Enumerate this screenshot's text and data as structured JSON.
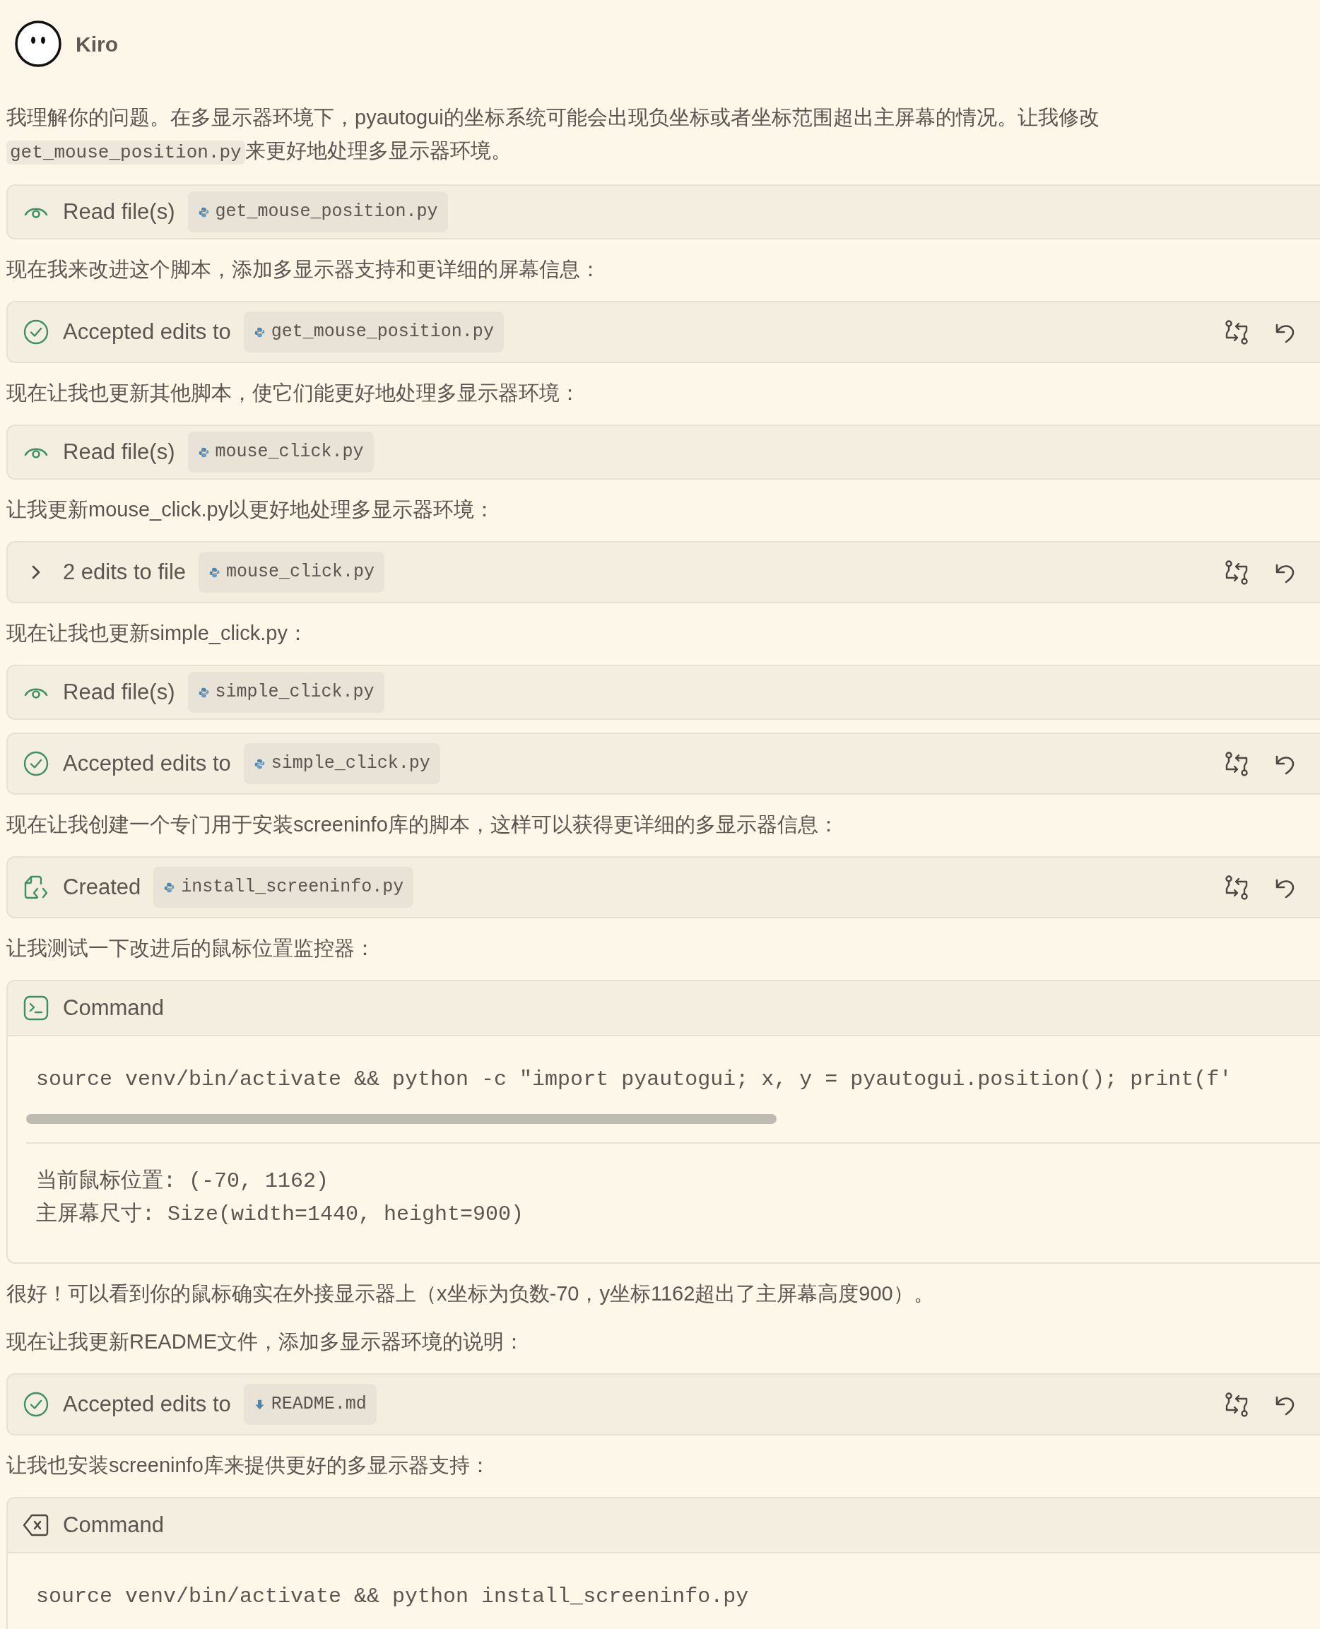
{
  "assistant": {
    "name": "Kiro"
  },
  "items": [
    {
      "kind": "text",
      "parts": [
        {
          "text": "我理解你的问题。在多显示器环境下，pyautogui的坐标系统可能会出现负坐标或者坐标范围超出主屏幕的情况。让我修改",
          "code": false
        },
        {
          "text": "get_mouse_position.py",
          "code": true
        },
        {
          "text": "来更好地处理多显示器环境。",
          "code": false
        }
      ]
    },
    {
      "kind": "read",
      "label": "Read file(s)",
      "file": {
        "name": "get_mouse_position.py",
        "kind": "python"
      },
      "actions": false
    },
    {
      "kind": "text",
      "parts": [
        {
          "text": "现在我来改进这个脚本，添加多显示器支持和更详细的屏幕信息：",
          "code": false
        }
      ]
    },
    {
      "kind": "accepted",
      "label": "Accepted edits to",
      "file": {
        "name": "get_mouse_position.py",
        "kind": "python"
      },
      "actions": true
    },
    {
      "kind": "text",
      "parts": [
        {
          "text": "现在让我也更新其他脚本，使它们能更好地处理多显示器环境：",
          "code": false
        }
      ]
    },
    {
      "kind": "read",
      "label": "Read file(s)",
      "file": {
        "name": "mouse_click.py",
        "kind": "python"
      },
      "actions": false
    },
    {
      "kind": "text",
      "parts": [
        {
          "text": "让我更新mouse_click.py以更好地处理多显示器环境：",
          "code": false
        }
      ]
    },
    {
      "kind": "edits",
      "label": "2 edits to file",
      "file": {
        "name": "mouse_click.py",
        "kind": "python"
      },
      "actions": true
    },
    {
      "kind": "text",
      "parts": [
        {
          "text": "现在让我也更新simple_click.py：",
          "code": false
        }
      ]
    },
    {
      "kind": "read",
      "label": "Read file(s)",
      "file": {
        "name": "simple_click.py",
        "kind": "python"
      },
      "actions": false
    },
    {
      "kind": "accepted",
      "label": "Accepted edits to",
      "file": {
        "name": "simple_click.py",
        "kind": "python"
      },
      "actions": true
    },
    {
      "kind": "text",
      "parts": [
        {
          "text": "现在让我创建一个专门用于安装screeninfo库的脚本，这样可以获得更详细的多显示器信息：",
          "code": false
        }
      ]
    },
    {
      "kind": "created",
      "label": "Created",
      "file": {
        "name": "install_screeninfo.py",
        "kind": "python"
      },
      "actions": true
    },
    {
      "kind": "text",
      "parts": [
        {
          "text": "让我测试一下改进后的鼠标位置监控器：",
          "code": false
        }
      ]
    },
    {
      "kind": "command",
      "label": "Command",
      "command": "source venv/bin/activate && python -c \"import pyautogui; x, y = pyautogui.position(); print(f'",
      "scrollable": true,
      "output": [
        "当前鼠标位置: (-70, 1162)",
        "主屏幕尺寸: Size(width=1440, height=900)"
      ]
    },
    {
      "kind": "text",
      "parts": [
        {
          "text": "很好！可以看到你的鼠标确实在外接显示器上（x坐标为负数-70，y坐标1162超出了主屏幕高度900）。",
          "code": false
        }
      ]
    },
    {
      "kind": "text",
      "parts": [
        {
          "text": "现在让我更新README文件，添加多显示器环境的说明：",
          "code": false
        }
      ]
    },
    {
      "kind": "accepted",
      "label": "Accepted edits to",
      "file": {
        "name": "README.md",
        "kind": "markdown"
      },
      "actions": true
    },
    {
      "kind": "text",
      "parts": [
        {
          "text": "让我也安装screeninfo库来提供更好的多显示器支持：",
          "code": false
        }
      ]
    },
    {
      "kind": "cancelled_command",
      "label": "Command",
      "command": "source venv/bin/activate && python install_screeninfo.py",
      "scrollable": false
    }
  ]
}
